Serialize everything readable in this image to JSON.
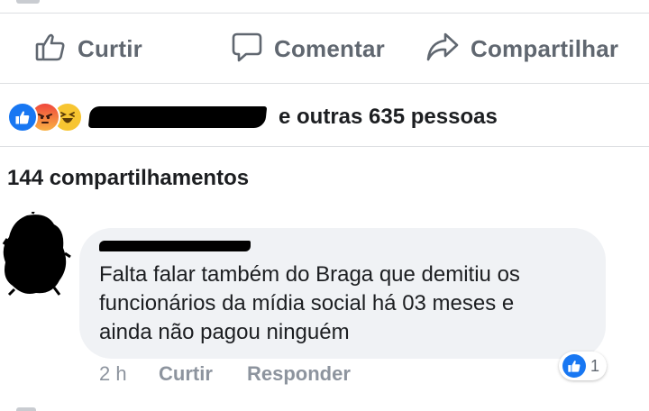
{
  "post_actions": {
    "like_label": "Curtir",
    "comment_label": "Comentar",
    "share_label": "Compartilhar"
  },
  "reactions": {
    "icons": [
      "like-icon",
      "angry-icon",
      "haha-icon"
    ],
    "others_text": "e outras 635 pessoas"
  },
  "shares": {
    "text": "144 compartilhamentos"
  },
  "comment": {
    "text": "Falta falar também do Braga que demitiu os\nfuncionários da mídia social há 03 meses e\nainda não pagou ninguém",
    "time": "2 h",
    "like_label": "Curtir",
    "reply_label": "Responder",
    "like_count": "1"
  },
  "colors": {
    "facebook_blue": "#1877f2",
    "muted_text": "#606770",
    "bubble_bg": "#f0f2f5",
    "divider": "#dddfe2"
  }
}
